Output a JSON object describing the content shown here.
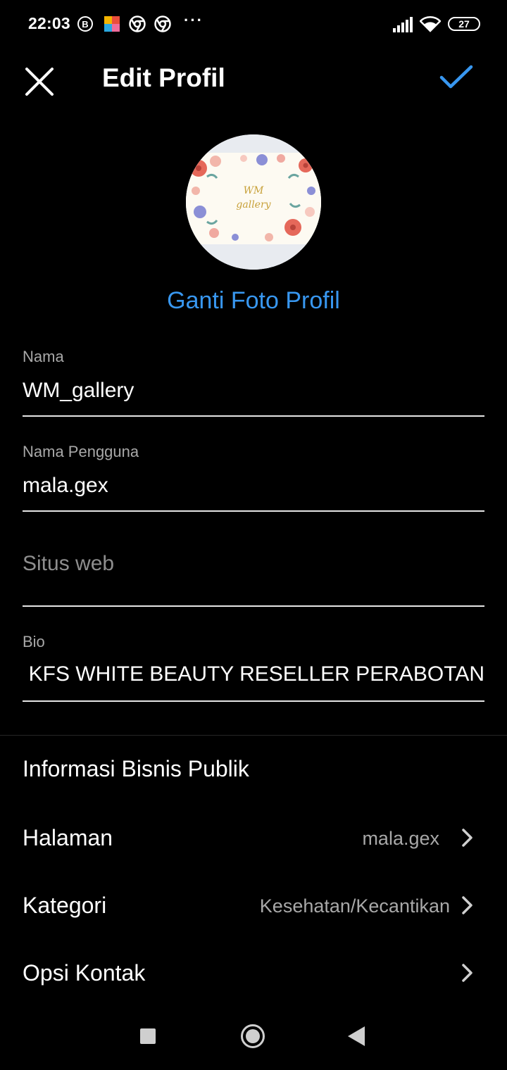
{
  "status_bar": {
    "time": "22:03",
    "b_badge": "B",
    "dots": "···",
    "battery": "27",
    "icons": [
      "b-icon",
      "kite-icon",
      "chrome-icon",
      "chrome-icon",
      "more-dots-icon",
      "signal-icon",
      "wifi-icon",
      "battery-icon"
    ]
  },
  "header": {
    "title": "Edit Profil",
    "close_icon": "close-icon",
    "save_icon": "check-icon",
    "accent": "#3897f0"
  },
  "profile": {
    "avatar_text_line1": "WM",
    "avatar_text_line2": "gallery",
    "change_photo": "Ganti Foto Profil"
  },
  "fields": {
    "name": {
      "label": "Nama",
      "value": "WM_gallery"
    },
    "username": {
      "label": "Nama Pengguna",
      "value": "mala.gex"
    },
    "website": {
      "placeholder": "Situs web"
    },
    "bio": {
      "label": "Bio",
      "value": "R KFS WHITE BEAUTY  RESELLER PERABOTAN"
    }
  },
  "business": {
    "section_title": "Informasi Bisnis Publik",
    "rows": [
      {
        "label": "Halaman",
        "value": "mala.gex"
      },
      {
        "label": "Kategori",
        "value": "Kesehatan/Kecantikan"
      },
      {
        "label": "Opsi Kontak",
        "value": ""
      }
    ]
  },
  "nav_bar": {
    "icons": [
      "recents-icon",
      "home-icon",
      "back-icon"
    ]
  }
}
